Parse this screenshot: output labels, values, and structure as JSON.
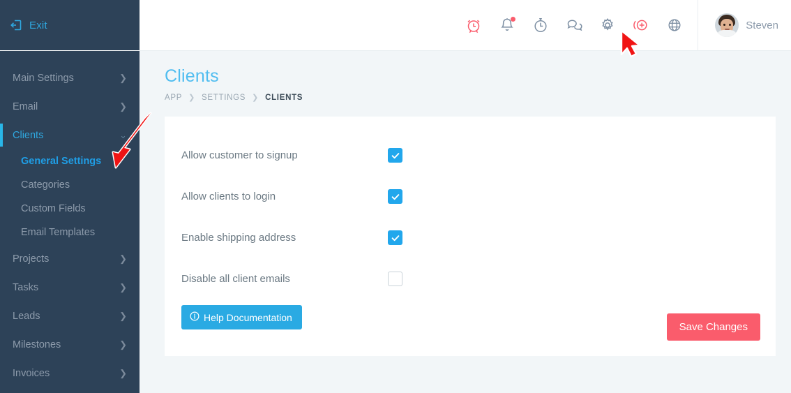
{
  "sidebar": {
    "exit": {
      "label": "Exit",
      "icon": "exit-icon"
    },
    "items": [
      {
        "label": "Main Settings",
        "state": "collapsed",
        "chevron": "chevron-right-icon"
      },
      {
        "label": "Email",
        "state": "collapsed",
        "chevron": "chevron-right-icon"
      },
      {
        "label": "Clients",
        "state": "expanded-active",
        "chevron": "chevron-down-icon"
      }
    ],
    "sub_items": [
      {
        "label": "General Settings",
        "active": true
      },
      {
        "label": "Categories",
        "active": false
      },
      {
        "label": "Custom Fields",
        "active": false
      },
      {
        "label": "Email Templates",
        "active": false
      }
    ],
    "items_lower": [
      {
        "label": "Projects",
        "chevron": "chevron-right-icon"
      },
      {
        "label": "Tasks",
        "chevron": "chevron-right-icon"
      },
      {
        "label": "Leads",
        "chevron": "chevron-right-icon"
      },
      {
        "label": "Milestones",
        "chevron": "chevron-right-icon"
      },
      {
        "label": "Invoices",
        "chevron": "chevron-right-icon"
      }
    ]
  },
  "topbar": {
    "icons": [
      {
        "name": "alarm-clock-icon",
        "color": "#fa5c6c"
      },
      {
        "name": "bell-icon",
        "color": "#7d8fa3",
        "badge": true
      },
      {
        "name": "stopwatch-icon",
        "color": "#7d8fa3"
      },
      {
        "name": "chat-bubbles-icon",
        "color": "#7d8fa3"
      },
      {
        "name": "gear-icon",
        "color": "#7d8fa3"
      },
      {
        "name": "add-circle-icon",
        "color": "#fa5c6c"
      },
      {
        "name": "globe-icon",
        "color": "#7d8fa3"
      }
    ],
    "user": {
      "name": "Steven",
      "avatar": "user-avatar"
    }
  },
  "page": {
    "title": "Clients",
    "breadcrumb": [
      {
        "label": "APP",
        "current": false
      },
      {
        "label": "SETTINGS",
        "current": false
      },
      {
        "label": "CLIENTS",
        "current": true
      }
    ]
  },
  "settings": [
    {
      "label": "Allow customer to signup",
      "checked": true
    },
    {
      "label": "Allow clients to login",
      "checked": true
    },
    {
      "label": "Enable shipping address",
      "checked": true
    },
    {
      "label": "Disable all client emails",
      "checked": false
    }
  ],
  "buttons": {
    "help": {
      "label": "Help Documentation",
      "icon": "info-circle-icon",
      "color": "#2aaae3"
    },
    "save": {
      "label": "Save Changes",
      "color": "#fa5c6c"
    }
  },
  "annotations": [
    {
      "name": "sidebar-arrow",
      "points_to": "General Settings",
      "color": "#f01414"
    },
    {
      "name": "cursor-arrow",
      "points_to": "gear-icon",
      "color": "#f01414"
    }
  ],
  "colors": {
    "sidebar_bg": "#2d4258",
    "accent_blue": "#2fa8e0",
    "page_bg": "#f2f6f8",
    "checkbox_blue": "#22a7ec",
    "save_red": "#fa5c6c"
  }
}
